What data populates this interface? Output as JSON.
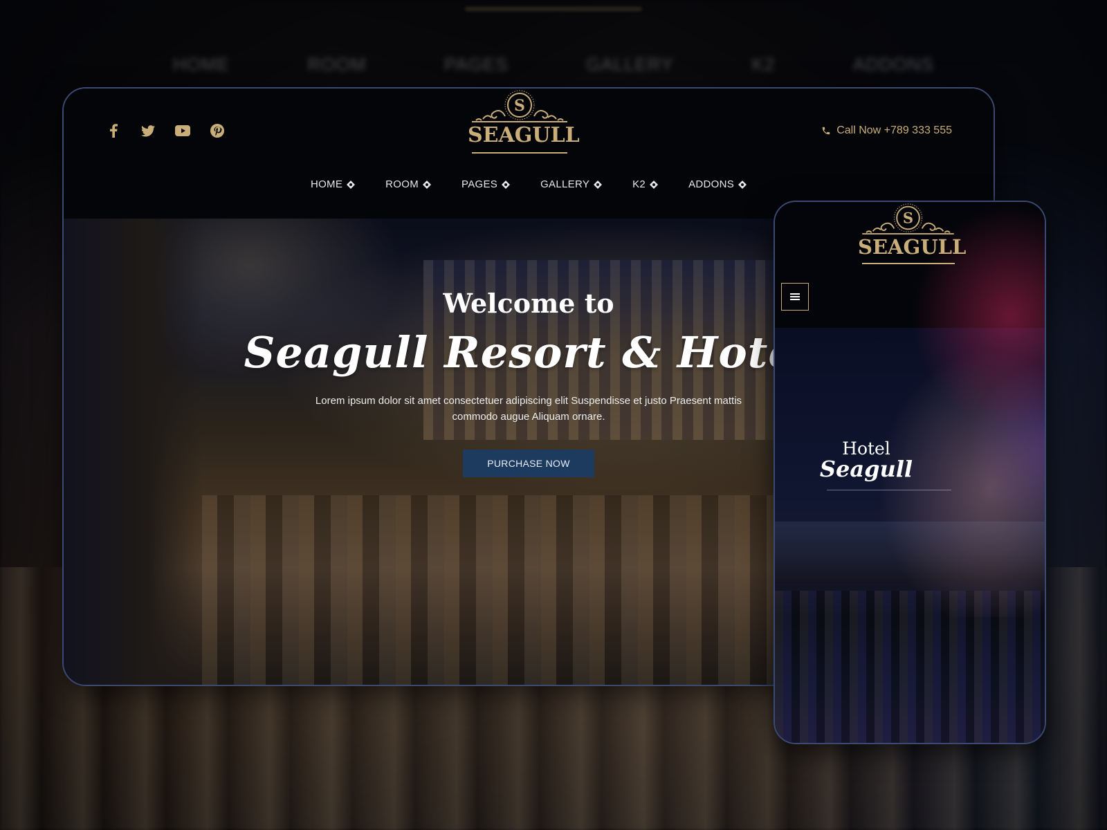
{
  "background": {
    "blurred_nav": [
      "HOME",
      "ROOM",
      "PAGES",
      "GALLERY",
      "K2",
      "ADDONS"
    ]
  },
  "desktop": {
    "social_icons": [
      "facebook-icon",
      "twitter-icon",
      "youtube-icon",
      "pinterest-icon"
    ],
    "logo": {
      "monogram": "S",
      "text": "SEAGULL"
    },
    "call": {
      "label": "Call Now +789 333 555",
      "icon": "phone-icon"
    },
    "nav": [
      {
        "label": "HOME"
      },
      {
        "label": "ROOM"
      },
      {
        "label": "PAGES"
      },
      {
        "label": "GALLERY"
      },
      {
        "label": "K2"
      },
      {
        "label": "ADDONS"
      }
    ],
    "hero": {
      "welcome": "Welcome to",
      "title": "Seagull Resort & Hotel",
      "description": "Lorem ipsum dolor sit amet consectetuer adipiscing elit Suspendisse et justo Praesent mattis commodo augue Aliquam ornare.",
      "button_label": "PURCHASE NOW"
    }
  },
  "mobile": {
    "logo": {
      "monogram": "S",
      "text": "SEAGULL"
    },
    "menu_icon": "hamburger-menu-icon",
    "hero": {
      "line1": "Hotel",
      "line2": "Seagull"
    }
  },
  "colors": {
    "gold": "#c9ae7a",
    "button": "#1d3a5f",
    "card_border": "#3a4a72"
  }
}
